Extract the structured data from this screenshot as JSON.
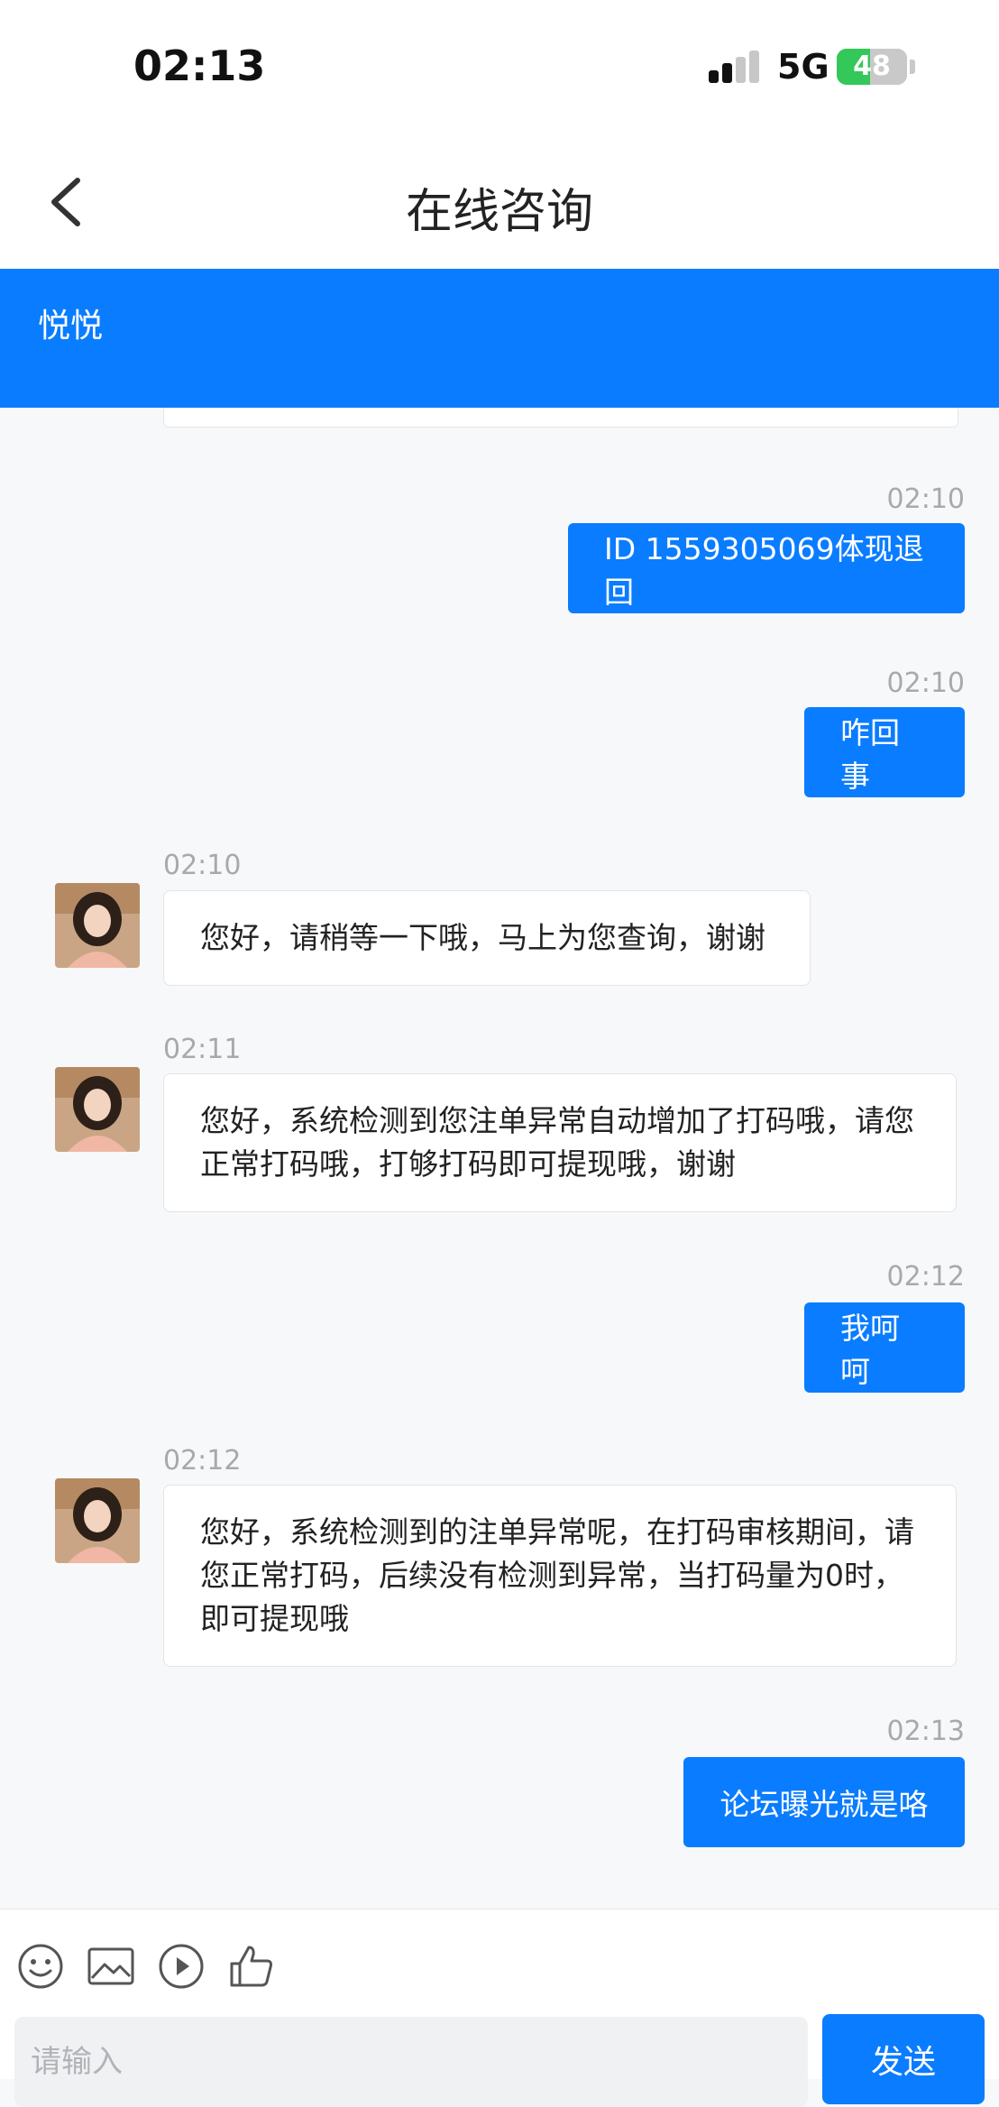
{
  "status_bar": {
    "time": "02:13",
    "network": "5G",
    "battery": "48",
    "battery_fraction": 0.48
  },
  "nav": {
    "title": "在线咨询"
  },
  "agent": {
    "name": "悦悦"
  },
  "messages": [
    {
      "time": "02:10",
      "text": "ID 1559305069体现退回"
    },
    {
      "time": "02:10",
      "text": "咋回事"
    },
    {
      "time": "02:10",
      "text": "您好，请稍等一下哦，马上为您查询，谢谢"
    },
    {
      "time": "02:11",
      "text": "您好，系统检测到您注单异常自动增加了打码哦，请您正常打码哦，打够打码即可提现哦，谢谢"
    },
    {
      "time": "02:12",
      "text": "我呵呵"
    },
    {
      "time": "02:12",
      "text": "您好，系统检测到的注单异常呢，在打码审核期间，请您正常打码，后续没有检测到异常，当打码量为0时，即可提现哦"
    },
    {
      "time": "02:13",
      "text": "论坛曝光就是咯"
    }
  ],
  "composer": {
    "placeholder": "请输入",
    "send_label": "发送"
  },
  "colors": {
    "accent": "#0a7cff",
    "background": "#f7f8fa"
  },
  "icons": [
    "emoji-icon",
    "image-icon",
    "video-icon",
    "thumbs-up-icon"
  ]
}
